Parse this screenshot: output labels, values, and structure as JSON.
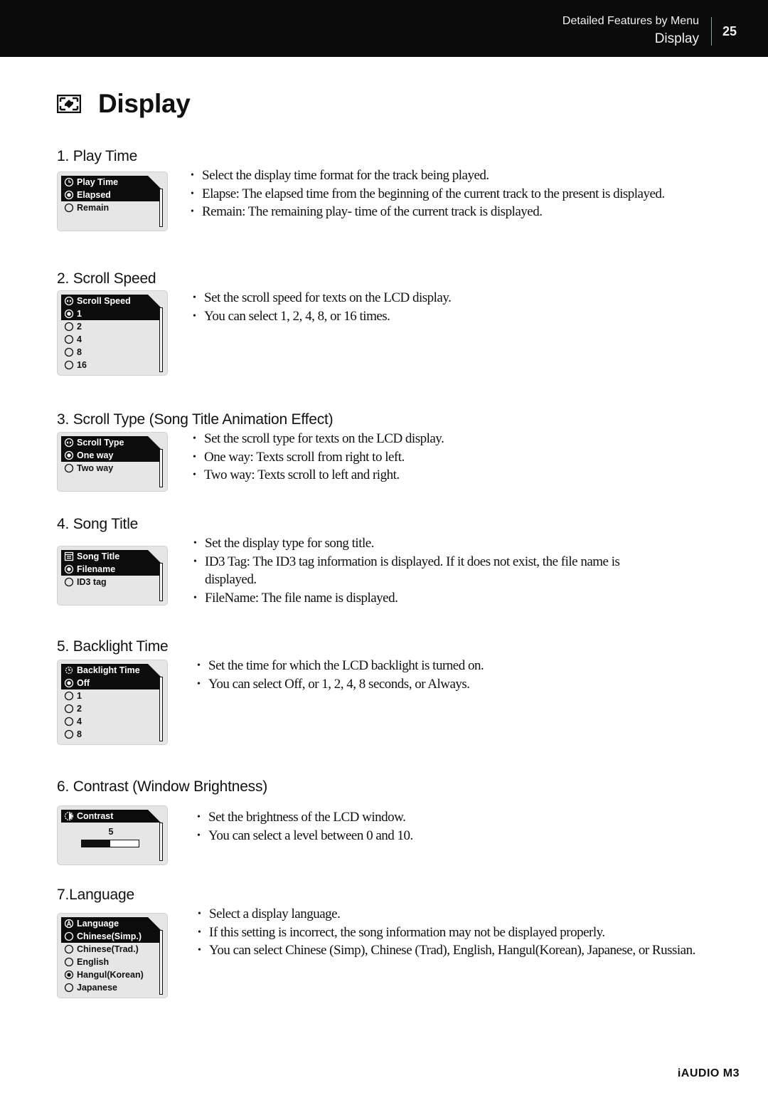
{
  "header": {
    "section_label": "Detailed Features by Menu",
    "current_label": "Display",
    "page_number": "25"
  },
  "page_title": {
    "icon": "display-icon",
    "title": "Display"
  },
  "sections": [
    {
      "title": "1. Play Time",
      "lcd": {
        "icon": "clock-icon",
        "header": "Play Time",
        "options": [
          {
            "label": "Elapsed",
            "selected": true
          },
          {
            "label": "Remain",
            "selected": false
          }
        ]
      },
      "bullets": [
        "Select the display time format for the track being played.",
        "Elapse: The elapsed time from the beginning of the current track to the present is displayed.",
        "Remain: The remaining play- time of the current track is displayed."
      ]
    },
    {
      "title": "2. Scroll Speed",
      "lcd": {
        "icon": "scroll-arrows-icon",
        "header": "Scroll Speed",
        "options": [
          {
            "label": "1",
            "selected": true
          },
          {
            "label": "2",
            "selected": false
          },
          {
            "label": "4",
            "selected": false
          },
          {
            "label": "8",
            "selected": false
          },
          {
            "label": "16",
            "selected": false
          }
        ]
      },
      "bullets": [
        "Set the scroll speed for texts on the LCD display.",
        "You can select 1, 2, 4, 8, or 16 times."
      ]
    },
    {
      "title": "3. Scroll Type (Song Title Animation Effect)",
      "lcd": {
        "icon": "scroll-arrows-icon",
        "header": "Scroll Type",
        "options": [
          {
            "label": "One way",
            "selected": true
          },
          {
            "label": "Two way",
            "selected": false
          }
        ]
      },
      "bullets": [
        "Set the scroll type for texts on the LCD display.",
        "One way: Texts scroll from right to left.",
        "Two way: Texts scroll to left and right."
      ]
    },
    {
      "title": "4. Song Title",
      "lcd": {
        "icon": "song-title-icon",
        "header": "Song Title",
        "options": [
          {
            "label": "Filename",
            "selected": true
          },
          {
            "label": "ID3 tag",
            "selected": false
          }
        ]
      },
      "bullets": [
        "Set the display type for song title.",
        "ID3 Tag: The ID3 tag information is displayed. If it does not exist, the file name is displayed.",
        "FileName: The file name is displayed."
      ]
    },
    {
      "title": "5. Backlight Time",
      "lcd": {
        "icon": "backlight-icon",
        "header": "Backlight Time",
        "options": [
          {
            "label": "Off",
            "selected": true
          },
          {
            "label": "1",
            "selected": false
          },
          {
            "label": "2",
            "selected": false
          },
          {
            "label": "4",
            "selected": false
          },
          {
            "label": "8",
            "selected": false
          }
        ]
      },
      "bullets": [
        "Set the time for which the LCD backlight is turned on.",
        "You can select Off, or 1, 2, 4, 8 seconds, or Always."
      ]
    },
    {
      "title": "6. Contrast (Window Brightness)",
      "lcd": {
        "icon": "contrast-icon",
        "header": "Contrast",
        "value": "5",
        "level_fraction": 0.5
      },
      "bullets": [
        "Set the brightness of the LCD window.",
        "You can select a level between 0 and 10."
      ]
    },
    {
      "title": "7.Language",
      "lcd": {
        "icon": "language-icon",
        "header": "Language",
        "highlighted": "Chinese(Simp.)",
        "options": [
          {
            "label": "Chinese(Simp.)",
            "selected": false,
            "highlight": true
          },
          {
            "label": "Chinese(Trad.)",
            "selected": false
          },
          {
            "label": "English",
            "selected": false
          },
          {
            "label": "Hangul(Korean)",
            "selected": true
          },
          {
            "label": "Japanese",
            "selected": false
          }
        ]
      },
      "bullets": [
        "Select a display language.",
        "If this setting is incorrect, the song information may not be displayed properly.",
        "You can select Chinese (Simp), Chinese (Trad), English, Hangul(Korean), Japanese, or Russian."
      ]
    }
  ],
  "footer": {
    "brand": "iAUDIO M3"
  }
}
